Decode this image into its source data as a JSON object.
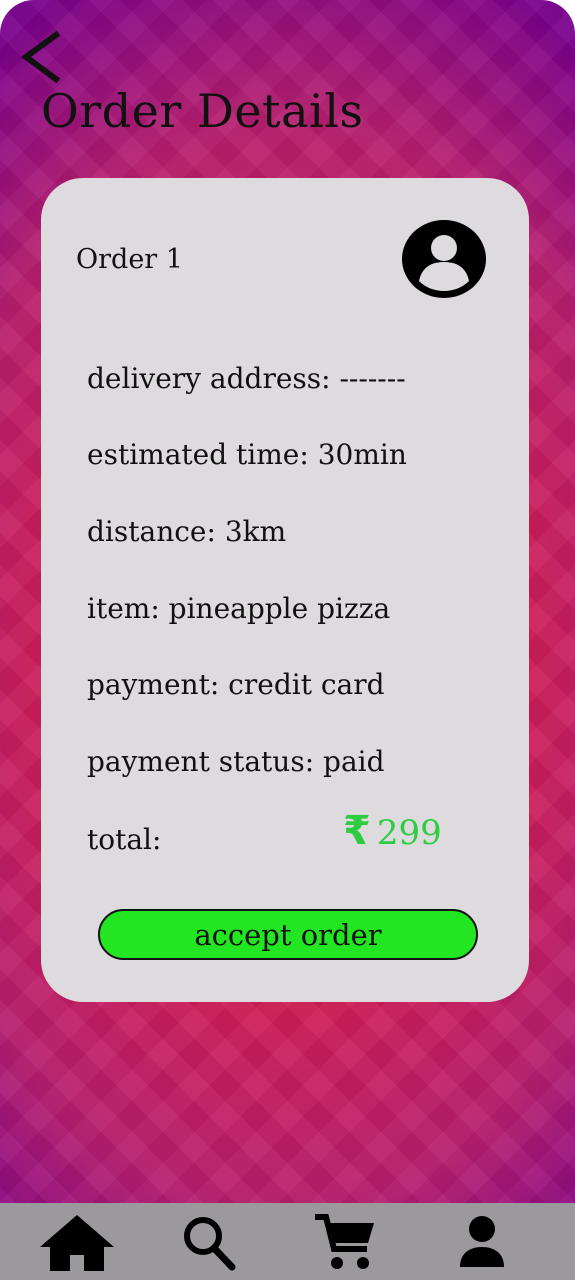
{
  "header": {
    "back_icon": "chevron-left-icon",
    "title": "Order Details"
  },
  "order": {
    "name": "Order 1",
    "avatar_icon": "user-avatar-icon",
    "delivery_address": "delivery address: -------",
    "estimated_time": "estimated time: 30min",
    "distance": "distance: 3km",
    "item": "item: pineapple pizza",
    "payment": "payment: credit card",
    "payment_status": "payment status: paid",
    "total_label": "total:",
    "currency_symbol": "₹",
    "total_value": "299",
    "accept_label": "accept order"
  },
  "nav": {
    "items": [
      {
        "icon": "home-icon"
      },
      {
        "icon": "search-icon"
      },
      {
        "icon": "cart-icon"
      },
      {
        "icon": "profile-icon"
      }
    ]
  },
  "colors": {
    "card_bg": "#dedbde",
    "accept_button": "#22e622",
    "price": "#2ecc40",
    "nav_bg": "#9b999c"
  }
}
